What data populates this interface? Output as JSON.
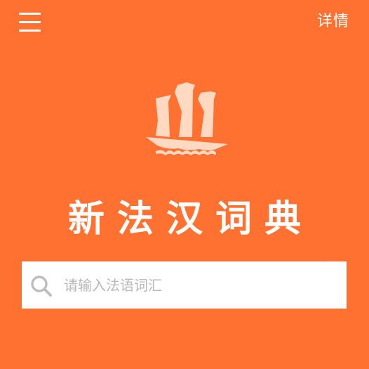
{
  "header": {
    "menu_icon": "hamburger-menu-icon",
    "details_label": "详情"
  },
  "logo": {
    "icon": "sailing-ship-icon"
  },
  "main": {
    "title": "新法汉词典"
  },
  "search": {
    "icon": "search-icon",
    "placeholder": "请输入法语词汇",
    "value": ""
  },
  "colors": {
    "background": "#ff7131",
    "header_text": "#ffffff",
    "title_text": "#ffffff",
    "logo_fill": "#ffd9c2",
    "search_bg": "#ffffff",
    "search_icon": "#bdbdbd",
    "placeholder": "#b8b8b8"
  }
}
